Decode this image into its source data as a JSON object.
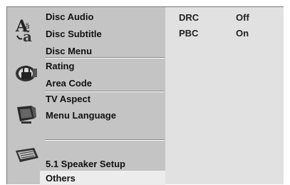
{
  "menu": {
    "groups": [
      {
        "icon": "language-icon",
        "items": [
          "Disc Audio",
          "Disc Subtitle",
          "Disc Menu"
        ]
      },
      {
        "icon": "lock-rating-icon",
        "items": [
          "Rating",
          "Area Code"
        ]
      },
      {
        "icon": "tv-icon",
        "items": [
          "TV Aspect",
          "Menu Language"
        ]
      },
      {
        "icon": "speaker-setup-icon",
        "items": [
          "5.1 Speaker Setup"
        ]
      }
    ],
    "selected": "Others"
  },
  "settings": [
    {
      "label": "DRC",
      "value": "Off"
    },
    {
      "label": "PBC",
      "value": "On"
    }
  ]
}
